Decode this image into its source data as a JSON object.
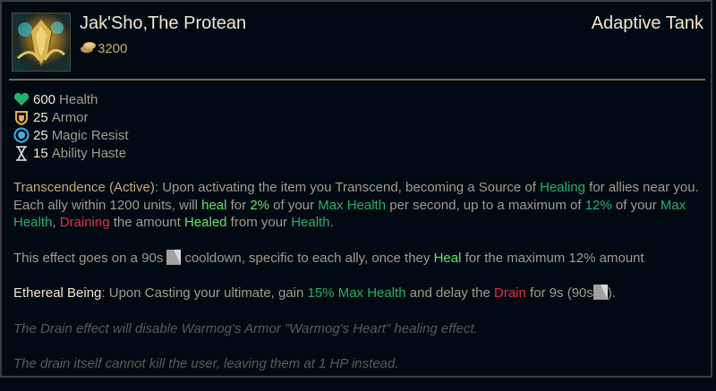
{
  "header": {
    "item_name": "Jak'Sho,The Protean",
    "item_tag": "Adaptive Tank",
    "cost": "3200",
    "item_icon": "jaksho-item-icon",
    "gold_icon": "gold-coins-icon"
  },
  "stats": [
    {
      "icon": "heart-icon",
      "value": "600",
      "label": "Health"
    },
    {
      "icon": "armor-icon",
      "value": "25",
      "label": "Armor"
    },
    {
      "icon": "magic-resist-icon",
      "value": "25",
      "label": "Magic Resist"
    },
    {
      "icon": "hourglass-icon",
      "value": "15",
      "label": "Ability Haste"
    }
  ],
  "passive1": {
    "name": "Transcendence (Active)",
    "t1": ": Upon activating the item you Transcend, becoming a Source of ",
    "healing": "Healing",
    "t2": " for allies near you. Each ally within 1200 units, will ",
    "heal": "heal",
    "t3": " for ",
    "pct2": "2%",
    "t4": " of your ",
    "maxhealth1": "Max Health",
    "t5": " per second, up to a maximum of ",
    "pct12": "12%",
    "t6": " of your ",
    "maxhealth2": "Max Health",
    "t7": ", ",
    "draining": "Draining",
    "t8": " the amount ",
    "healed": "Healed",
    "t9": " from your ",
    "health": "Health",
    "t10": "."
  },
  "cooldown": {
    "t1": "This effect goes on a 90s",
    "t2": "cooldown, specific to each ally, once they ",
    "heal": "Heal",
    "t3": " for the maximum 12% amount"
  },
  "passive2": {
    "name": "Ethereal Being",
    "t1": ": Upon Casting your ultimate, gain ",
    "maxhealth": "15% Max Health",
    "t2": " and delay the ",
    "drain": "Drain",
    "t3": " for 9s (90s",
    "t4": ")."
  },
  "notes": [
    "The Drain effect will disable Warmog's Armor \"Warmog's Heart\" healing effect.",
    "The drain itself cannot kill the user, leaving them at 1 HP instead."
  ],
  "colors": {
    "gold": "#c8aa6e",
    "green": "#27b069",
    "heal_green": "#64e464",
    "red": "#e0314b",
    "text": "#a09b8c",
    "bright": "#f0e6d2"
  }
}
